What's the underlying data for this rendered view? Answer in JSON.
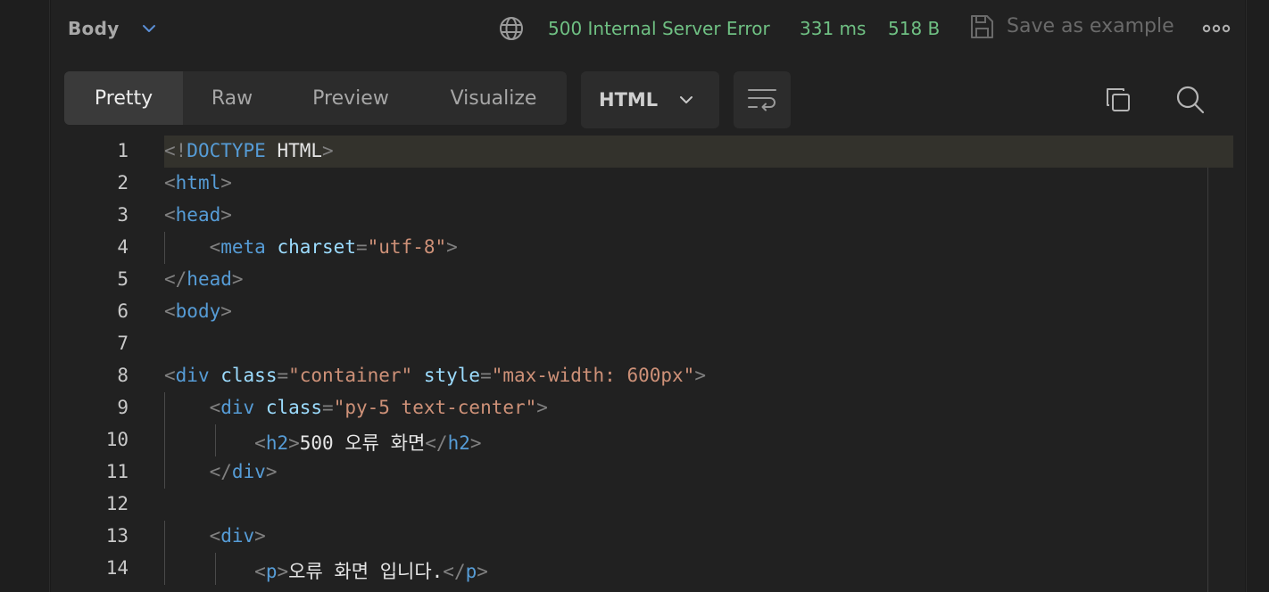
{
  "response": {
    "section_label": "Body",
    "status": "500 Internal Server Error",
    "time": "331 ms",
    "size": "518 B",
    "save_label": "Save as example"
  },
  "view_tabs": [
    {
      "label": "Pretty",
      "active": true
    },
    {
      "label": "Raw",
      "active": false
    },
    {
      "label": "Preview",
      "active": false
    },
    {
      "label": "Visualize",
      "active": false
    }
  ],
  "format": {
    "selected": "HTML"
  },
  "editor": {
    "highlighted_line": 1,
    "lines": [
      {
        "no": "1",
        "tokens": [
          [
            "p",
            "<!"
          ],
          [
            "t",
            "DOCTYPE"
          ],
          [
            "tx",
            " HTML"
          ],
          [
            "p",
            ">"
          ]
        ]
      },
      {
        "no": "2",
        "tokens": [
          [
            "p",
            "<"
          ],
          [
            "t",
            "html"
          ],
          [
            "p",
            ">"
          ]
        ]
      },
      {
        "no": "3",
        "tokens": [
          [
            "p",
            "<"
          ],
          [
            "t",
            "head"
          ],
          [
            "p",
            ">"
          ]
        ]
      },
      {
        "no": "4",
        "tokens": [
          [
            "tx",
            "    "
          ],
          [
            "p",
            "<"
          ],
          [
            "t",
            "meta"
          ],
          [
            "tx",
            " "
          ],
          [
            "a",
            "charset"
          ],
          [
            "p",
            "="
          ],
          [
            "s",
            "\"utf-8\""
          ],
          [
            "p",
            ">"
          ]
        ]
      },
      {
        "no": "5",
        "tokens": [
          [
            "p",
            "</"
          ],
          [
            "t",
            "head"
          ],
          [
            "p",
            ">"
          ]
        ]
      },
      {
        "no": "6",
        "tokens": [
          [
            "p",
            "<"
          ],
          [
            "t",
            "body"
          ],
          [
            "p",
            ">"
          ]
        ]
      },
      {
        "no": "7",
        "tokens": []
      },
      {
        "no": "8",
        "tokens": [
          [
            "p",
            "<"
          ],
          [
            "t",
            "div"
          ],
          [
            "tx",
            " "
          ],
          [
            "a",
            "class"
          ],
          [
            "p",
            "="
          ],
          [
            "s",
            "\"container\""
          ],
          [
            "tx",
            " "
          ],
          [
            "a",
            "style"
          ],
          [
            "p",
            "="
          ],
          [
            "s",
            "\"max-width: 600px\""
          ],
          [
            "p",
            ">"
          ]
        ]
      },
      {
        "no": "9",
        "tokens": [
          [
            "tx",
            "    "
          ],
          [
            "p",
            "<"
          ],
          [
            "t",
            "div"
          ],
          [
            "tx",
            " "
          ],
          [
            "a",
            "class"
          ],
          [
            "p",
            "="
          ],
          [
            "s",
            "\"py-5 text-center\""
          ],
          [
            "p",
            ">"
          ]
        ]
      },
      {
        "no": "10",
        "tokens": [
          [
            "tx",
            "        "
          ],
          [
            "p",
            "<"
          ],
          [
            "t",
            "h2"
          ],
          [
            "p",
            ">"
          ],
          [
            "tx",
            "500 오류 화면"
          ],
          [
            "p",
            "</"
          ],
          [
            "t",
            "h2"
          ],
          [
            "p",
            ">"
          ]
        ]
      },
      {
        "no": "11",
        "tokens": [
          [
            "tx",
            "    "
          ],
          [
            "p",
            "</"
          ],
          [
            "t",
            "div"
          ],
          [
            "p",
            ">"
          ]
        ]
      },
      {
        "no": "12",
        "tokens": []
      },
      {
        "no": "13",
        "tokens": [
          [
            "tx",
            "    "
          ],
          [
            "p",
            "<"
          ],
          [
            "t",
            "div"
          ],
          [
            "p",
            ">"
          ]
        ]
      },
      {
        "no": "14",
        "tokens": [
          [
            "tx",
            "        "
          ],
          [
            "p",
            "<"
          ],
          [
            "t",
            "p"
          ],
          [
            "p",
            ">"
          ],
          [
            "tx",
            "오류 화면 입니다."
          ],
          [
            "p",
            "</"
          ],
          [
            "t",
            "p"
          ],
          [
            "p",
            ">"
          ]
        ]
      }
    ]
  },
  "icons": {
    "body_dropdown": "chevron-down-icon",
    "network": "globe-icon",
    "save": "save-icon",
    "more": "more-icon",
    "format_dropdown": "chevron-down-icon",
    "wrap": "wrap-lines-icon",
    "copy": "copy-icon",
    "search": "search-icon"
  },
  "colors": {
    "status": "#6fc083",
    "tag": "#569cd6",
    "attribute": "#9cdcfe",
    "string": "#ce9178",
    "punctuation": "#808080"
  }
}
